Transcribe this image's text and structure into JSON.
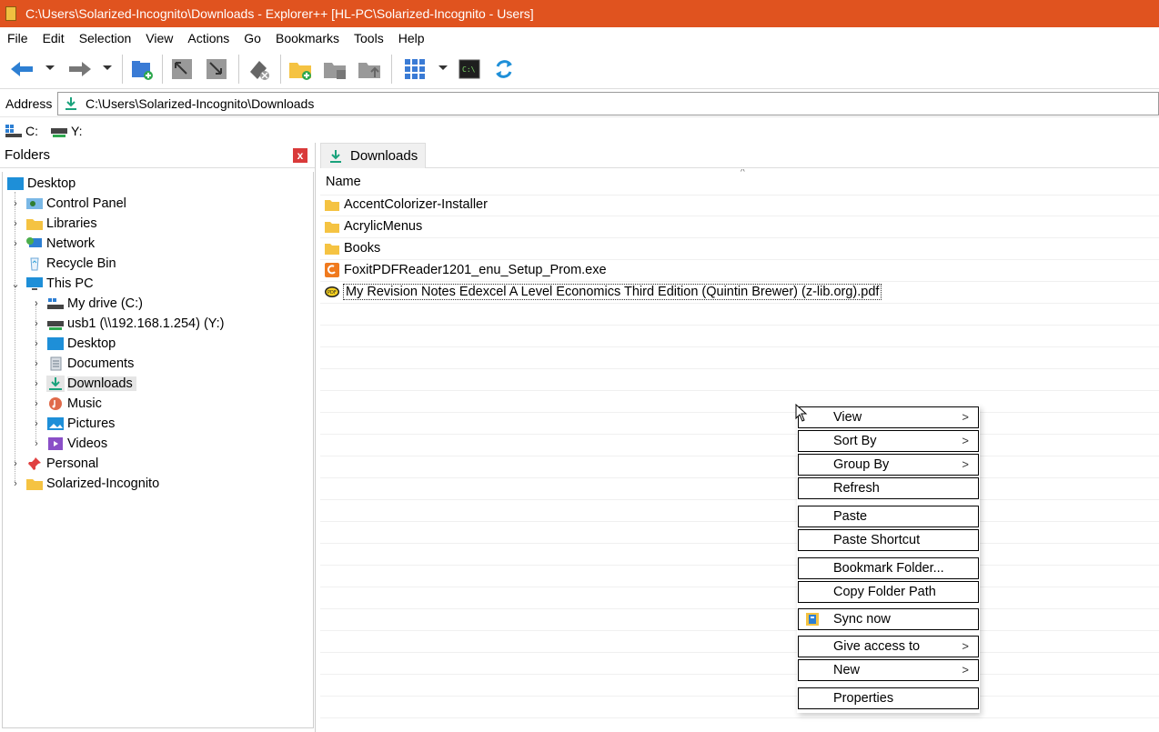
{
  "window": {
    "title": "C:\\Users\\Solarized-Incognito\\Downloads - Explorer++ [HL-PC\\Solarized-Incognito - Users]"
  },
  "menu": [
    "File",
    "Edit",
    "Selection",
    "View",
    "Actions",
    "Go",
    "Bookmarks",
    "Tools",
    "Help"
  ],
  "address": {
    "label": "Address",
    "path": "C:\\Users\\Solarized-Incognito\\Downloads"
  },
  "drives": [
    "C:",
    "Y:"
  ],
  "folders_pane": {
    "title": "Folders",
    "close": "x",
    "tree": [
      "Desktop",
      "Control Panel",
      "Libraries",
      "Network",
      "Recycle Bin",
      "This PC",
      "My drive (C:)",
      "usb1 (\\\\192.168.1.254) (Y:)",
      "Desktop",
      "Documents",
      "Downloads",
      "Music",
      "Pictures",
      "Videos",
      "Personal",
      "Solarized-Incognito"
    ]
  },
  "tab": {
    "label": "Downloads"
  },
  "file_list": {
    "column": "Name",
    "sort_indicator": "^",
    "files": [
      "AccentColorizer-Installer",
      "AcrylicMenus",
      "Books",
      "FoxitPDFReader1201_enu_Setup_Prom.exe",
      "My Revision Notes Edexcel A Level Economics Third Edition (Quintin Brewer) (z-lib.org).pdf"
    ]
  },
  "context_menu": {
    "chevron": ">",
    "items": [
      "View",
      "Sort By",
      "Group By",
      "Refresh",
      "Paste",
      "Paste Shortcut",
      "Bookmark Folder...",
      "Copy Folder Path",
      "Sync now",
      "Give access to",
      "New",
      "Properties"
    ]
  },
  "colors": {
    "titlebar": "#e0531f",
    "folder": "#f5c342",
    "accent_blue": "#1e8fd8",
    "teal": "#1aa27c"
  },
  "icons": [
    "back-arrow-icon",
    "forward-arrow-icon",
    "new-tab-icon",
    "folder-icon",
    "download-icon",
    "drive-icon",
    "pdf-icon",
    "exe-icon",
    "chevron-right-icon"
  ]
}
